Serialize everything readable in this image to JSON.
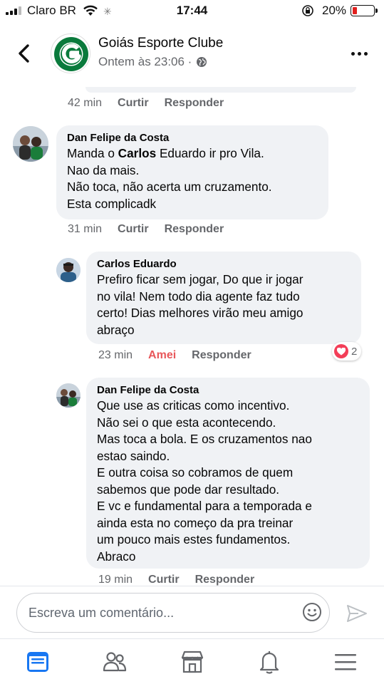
{
  "status_bar": {
    "carrier": "Claro BR",
    "time": "17:44",
    "battery": "20%",
    "battery_level": 0.2
  },
  "header": {
    "page_name": "Goiás Esporte Clube",
    "post_time": "Ontem às 23:06 ·",
    "logo_text": "GOIÁS ESPORTE CLUBE · 6-4-1943"
  },
  "previous_comment": {
    "time": "42 min",
    "like_label": "Curtir",
    "reply_label": "Responder"
  },
  "comments": [
    {
      "author": "Dan Felipe da Costa",
      "lines": [
        [
          "Manda o ",
          "Carlos",
          " Eduardo ir pro Vila."
        ],
        "Nao da mais.",
        "Não toca, não acerta um cruzamento.",
        "Esta complicadk"
      ],
      "time": "31 min",
      "like_label": "Curtir",
      "reply_label": "Responder"
    },
    {
      "author": "Carlos Eduardo",
      "lines": [
        "Prefiro ficar sem jogar, Do que ir jogar",
        "no vila! Nem todo dia agente faz tudo",
        "certo! Dias melhores virão meu amigo",
        "abraço"
      ],
      "time": "23 min",
      "like_label": "Amei",
      "reply_label": "Responder",
      "reaction_count": "2"
    },
    {
      "author": "Dan Felipe da Costa",
      "lines": [
        "Que use as criticas como incentivo.",
        "Não sei o que esta acontecendo.",
        "Mas toca a bola. E os cruzamentos nao",
        "estao saindo.",
        "E outra coisa so cobramos de quem",
        "sabemos que pode dar resultado.",
        "E vc e fundamental para a temporada e",
        "ainda esta no começo da pra treinar",
        "um pouco mais estes fundamentos.",
        "Abraco"
      ],
      "time": "19 min",
      "like_label": "Curtir",
      "reply_label": "Responder"
    }
  ],
  "composer": {
    "placeholder": "Escreva um comentário..."
  },
  "bottom_nav": [
    "feed-icon",
    "groups-icon",
    "marketplace-icon",
    "notifications-icon",
    "menu-icon"
  ],
  "colors": {
    "facebook_blue": "#1877f2",
    "bubble_gray": "#f0f2f5",
    "love_red": "#f33e58",
    "goias_green": "#0a7a3c"
  }
}
